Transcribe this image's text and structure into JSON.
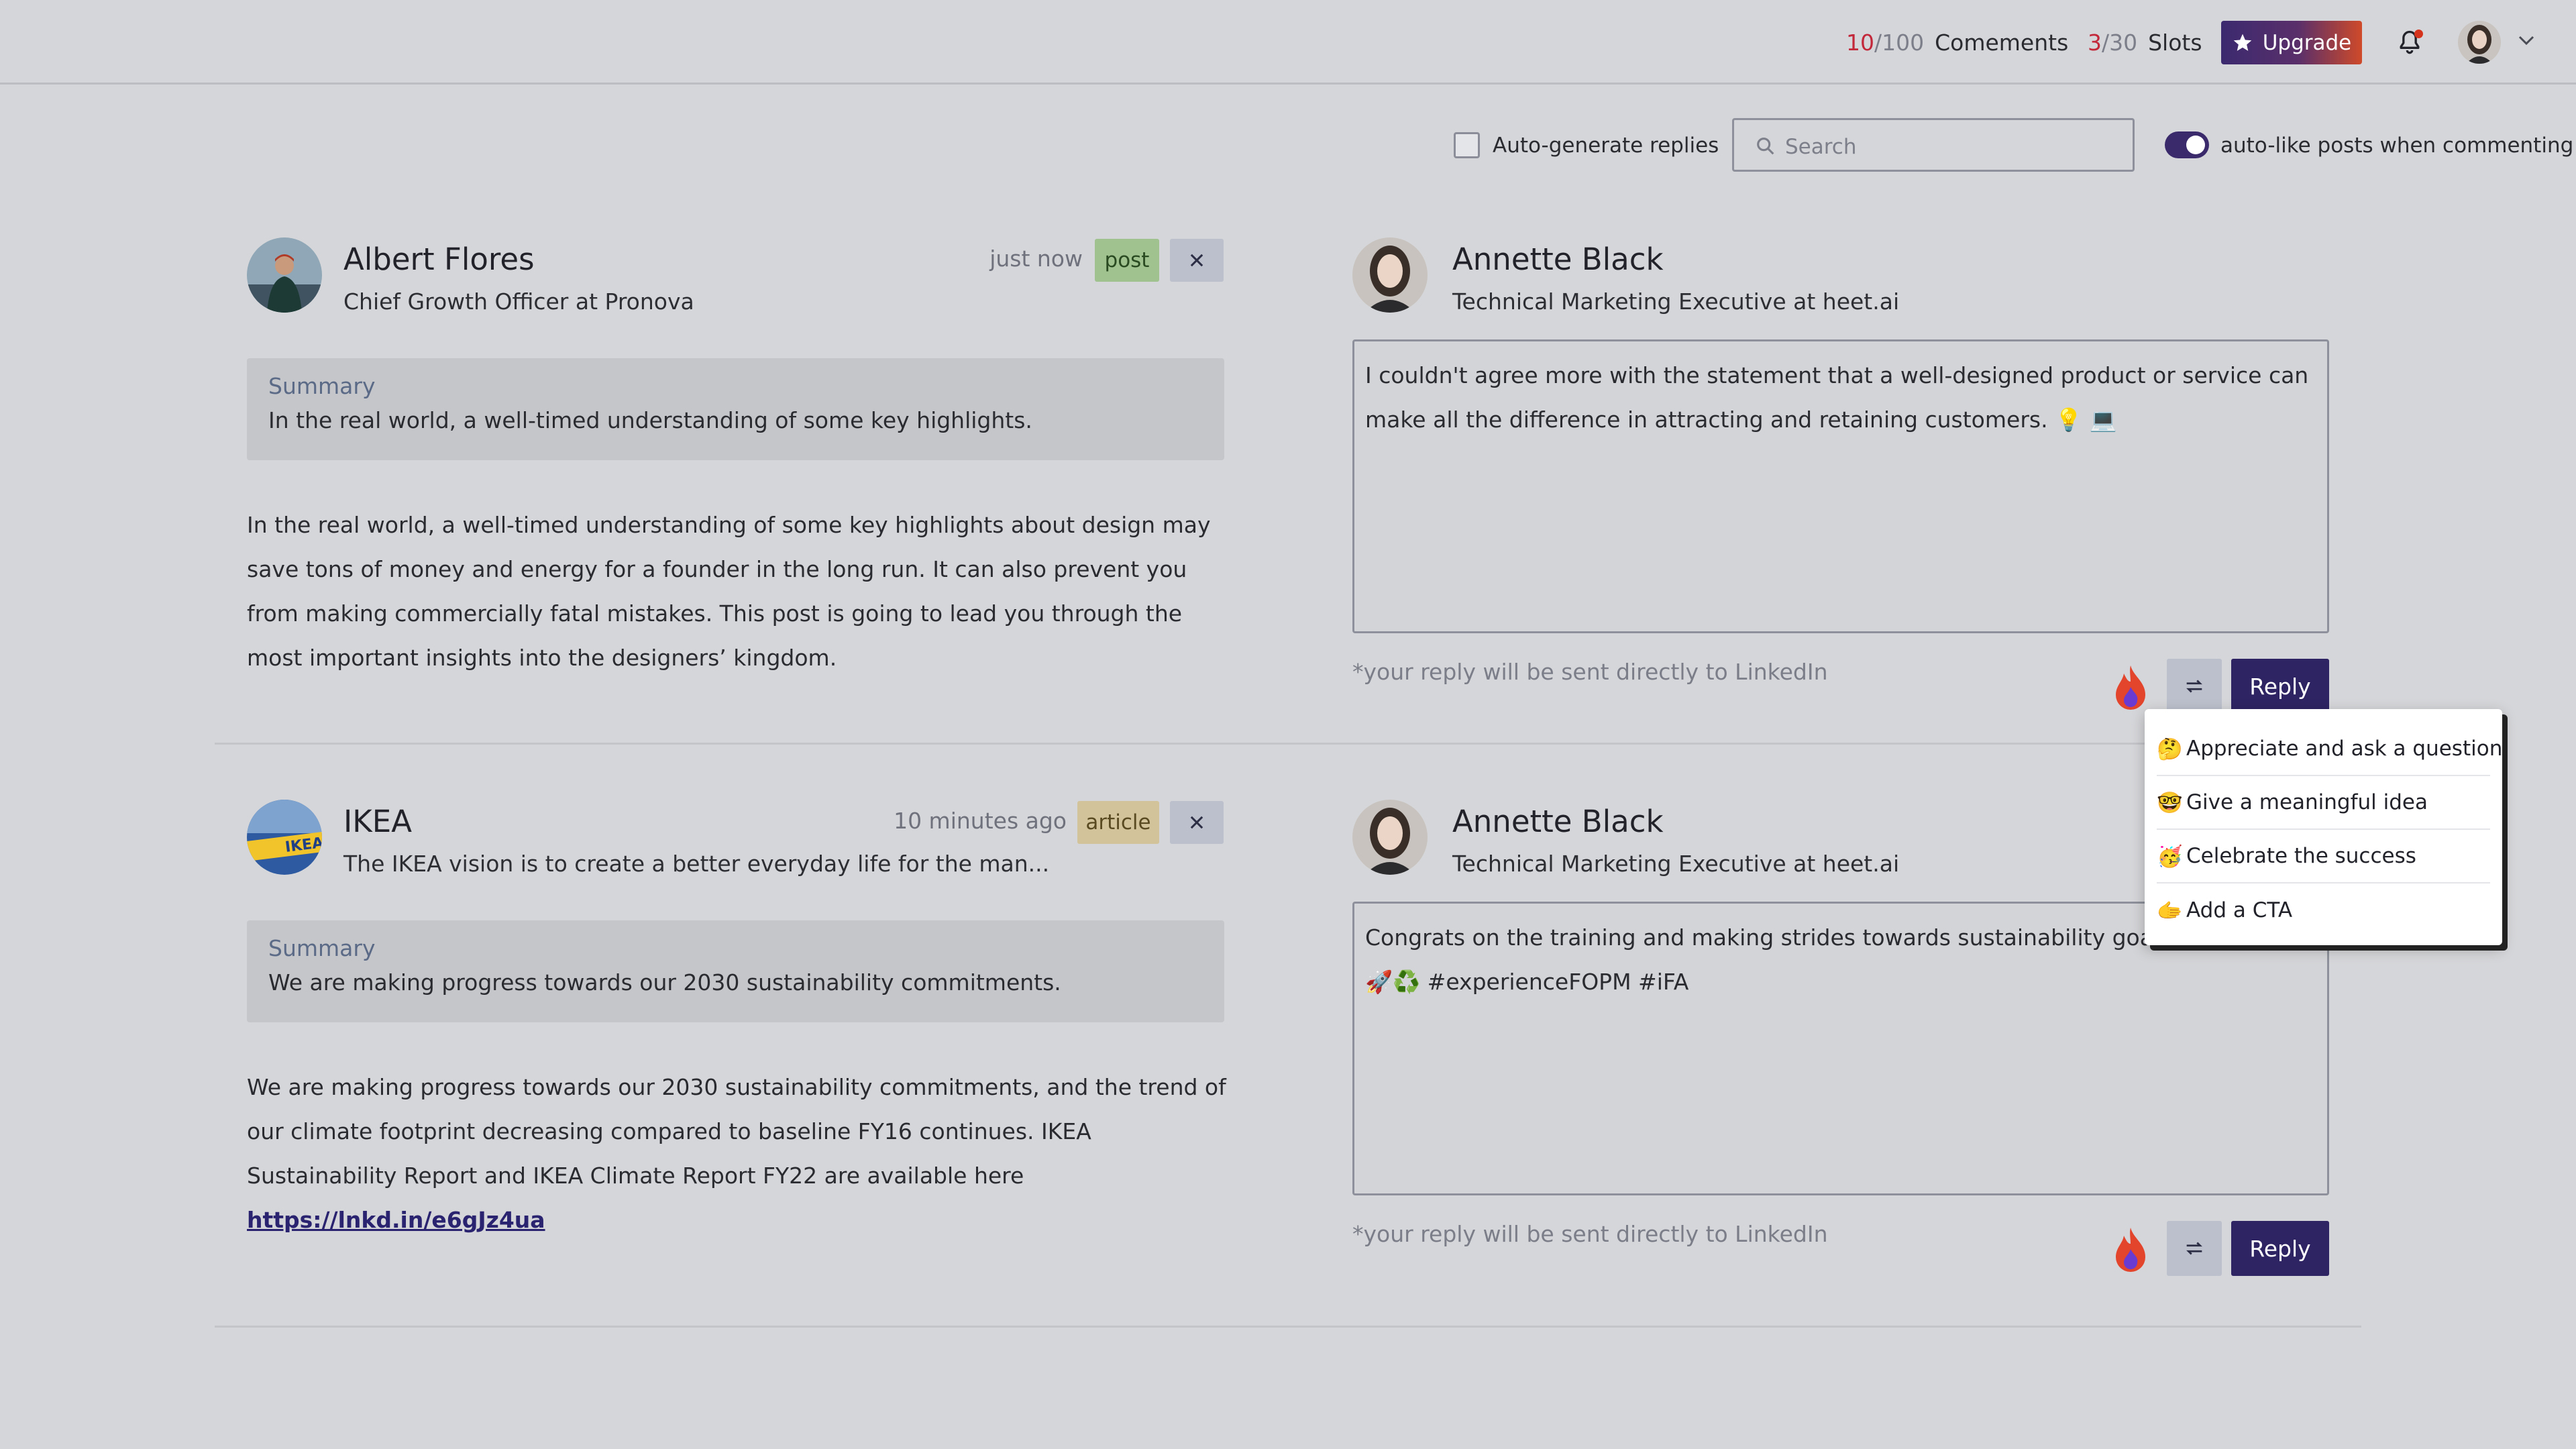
{
  "topbar": {
    "comments_count": "10",
    "comments_limit": "/100",
    "comments_label": "Comements",
    "slots_count": "3",
    "slots_limit": "/30",
    "slots_label": "Slots",
    "upgrade_label": "Upgrade",
    "notification_dot": true
  },
  "controls": {
    "auto_generate_label": "Auto-generate replies",
    "auto_generate_checked": false,
    "search_placeholder": "Search",
    "auto_like_label": "auto-like posts when commenting",
    "auto_like_enabled": true
  },
  "posts": [
    {
      "author": "Albert Flores",
      "headline": "Chief Growth Officer at Pronova",
      "time": "just now",
      "type": "post",
      "summary_title": "Summary",
      "summary": "In the real world, a well-timed understanding  of some key highlights.",
      "body": "In the real world, a well-timed understanding of some key highlights about design may save tons of money and energy for a founder in the long run. It can also prevent you from making commercially fatal mistakes. This post is going to lead you through the most important insights into the designers’ kingdom.",
      "reply": {
        "author": "Annette Black",
        "headline": "Technical Marketing Executive at heet.ai",
        "text": "I couldn't agree more with the statement that a well-designed product or service can make all the difference in attracting and retaining customers. 💡 💻",
        "note": "*your reply will be sent directly to LinkedIn",
        "button": "Reply"
      }
    },
    {
      "author": "IKEA",
      "headline": "The IKEA vision is to create a better everyday life for the man...",
      "time": "10 minutes ago",
      "type": "article",
      "summary_title": "Summary",
      "summary": "We are making progress towards our 2030 sustainability commitments.",
      "body": "We are making progress towards our 2030 sustainability commitments, and the trend of our climate footprint decreasing compared to baseline FY16 continues. IKEA Sustainability Report and IKEA Climate Report FY22 are available here",
      "link": "https://lnkd.in/e6gJz4ua",
      "reply": {
        "author": "Annette Black",
        "headline": "Technical Marketing Executive at heet.ai",
        "text": "Congrats on the training and making strides towards sustainability goals, kee",
        "text2": "🚀♻️ #experienceFOPM #iFA",
        "note": "*your reply will be sent directly to LinkedIn",
        "button": "Reply"
      }
    }
  ],
  "dropdown": {
    "items": [
      {
        "emoji": "🤔",
        "label": "Appreciate and ask a question"
      },
      {
        "emoji": "🤓",
        "label": "Give a meaningful idea"
      },
      {
        "emoji": "🥳",
        "label": "Celebrate the success"
      },
      {
        "emoji": "🫱",
        "label": "Add a CTA"
      }
    ]
  },
  "colors": {
    "accent": "#2e2463",
    "count_red": "#c2273a",
    "badge_post": "#9fc28f",
    "badge_article": "#d3c39a",
    "background": "#d5d6d9"
  }
}
